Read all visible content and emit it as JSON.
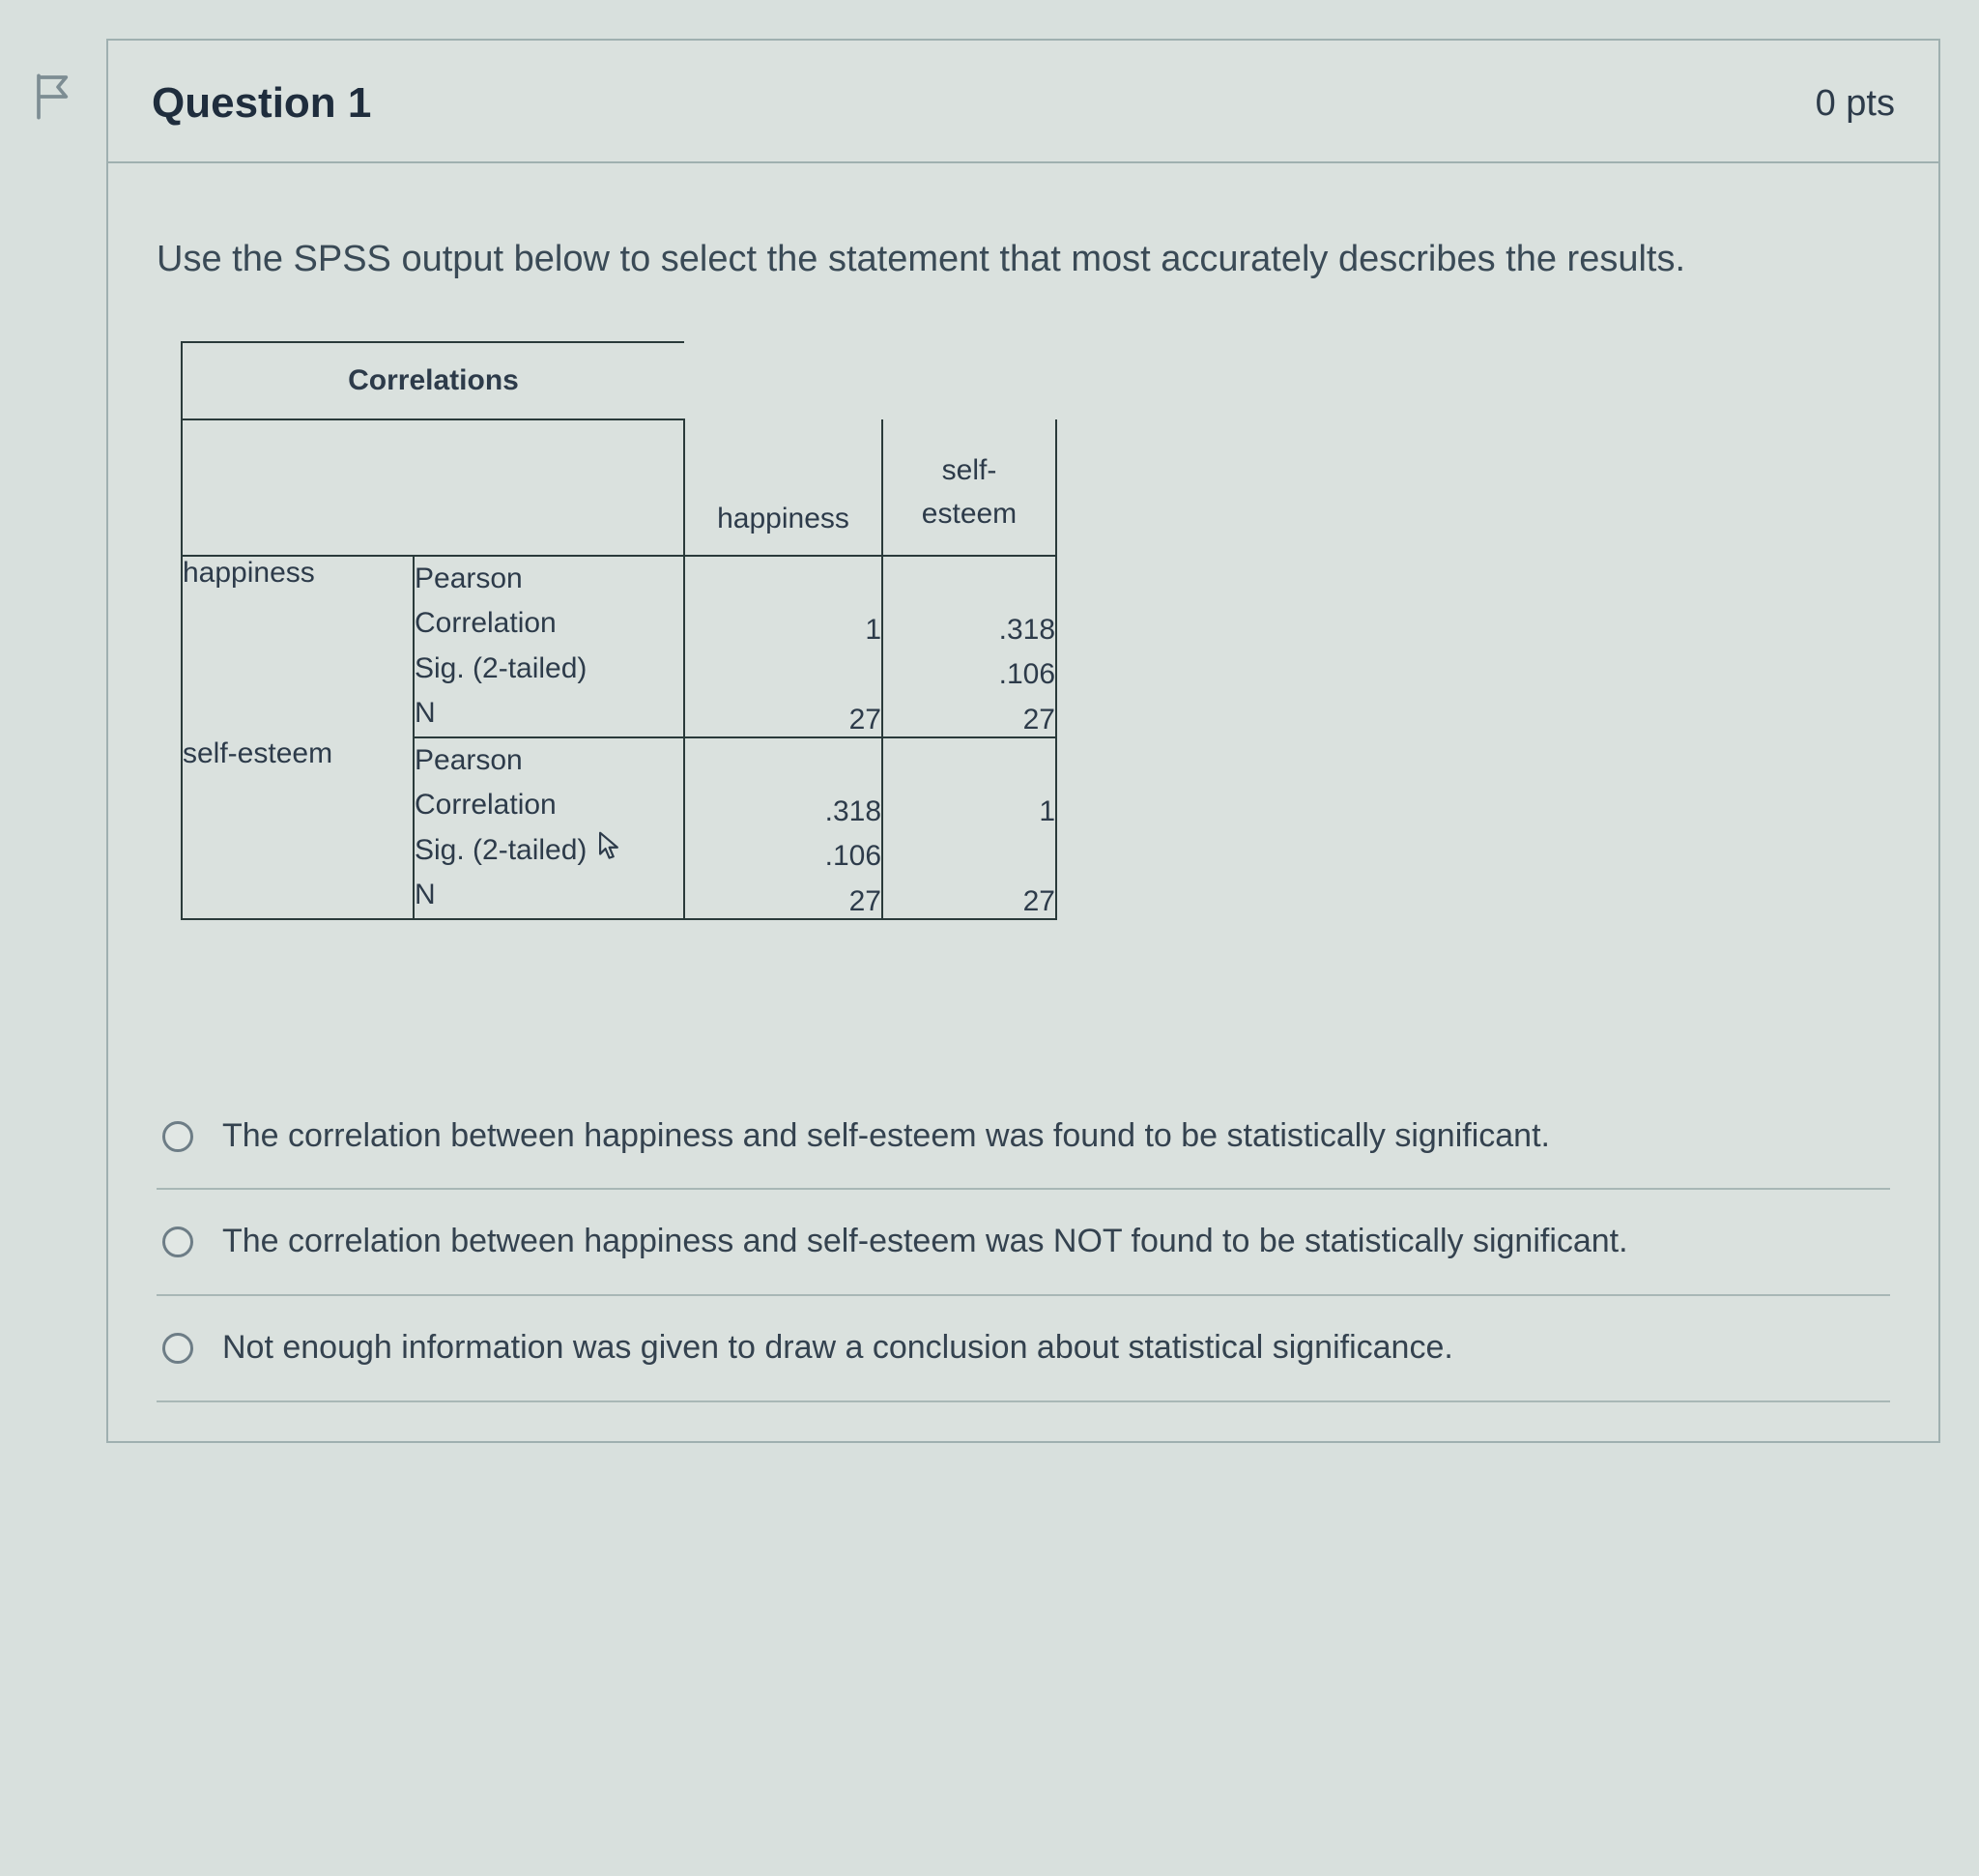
{
  "question": {
    "title": "Question 1",
    "points": "0 pts",
    "prompt": "Use the SPSS output below to select the statement that most accurately describes the results."
  },
  "spss": {
    "title": "Correlations",
    "col1": "happiness",
    "col2_line1": "self-",
    "col2_line2": "esteem",
    "rows": {
      "happiness": {
        "label": "happiness",
        "pearson_l1": "Pearson",
        "pearson_l2": "Correlation",
        "sig_label": "Sig. (2-tailed)",
        "n_label": "N",
        "pearson_v1": "1",
        "pearson_v2": ".318",
        "sig_v1": "",
        "sig_v2": ".106",
        "n_v1": "27",
        "n_v2": "27"
      },
      "self_esteem": {
        "label": "self-esteem",
        "pearson_l1": "Pearson",
        "pearson_l2": "Correlation",
        "sig_label": "Sig. (2-tailed)",
        "n_label": "N",
        "pearson_v1": ".318",
        "pearson_v2": "1",
        "sig_v1": ".106",
        "sig_v2": "",
        "n_v1": "27",
        "n_v2": "27"
      }
    }
  },
  "answers": {
    "a1": "The correlation between happiness and self-esteem was found to be statistically significant.",
    "a2": "The correlation between happiness and self-esteem was NOT found to be statistically significant.",
    "a3": "Not enough information was given to draw a conclusion about statistical significance."
  }
}
